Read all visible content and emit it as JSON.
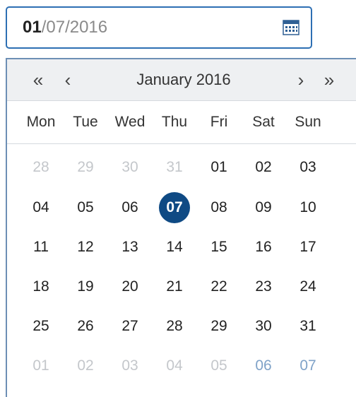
{
  "input": {
    "active_segment": "01",
    "rest": "/07/2016",
    "icon": "calendar-icon"
  },
  "calendar": {
    "prev_year": "«",
    "prev_month": "‹",
    "title": "January 2016",
    "next_month": "›",
    "next_year": "»",
    "weekdays": [
      "Mon",
      "Tue",
      "Wed",
      "Thu",
      "Fri",
      "Sat",
      "Sun"
    ],
    "selected_day": "07",
    "weeks": [
      [
        {
          "label": "28",
          "state": "other"
        },
        {
          "label": "29",
          "state": "other"
        },
        {
          "label": "30",
          "state": "other"
        },
        {
          "label": "31",
          "state": "other"
        },
        {
          "label": "01",
          "state": "current"
        },
        {
          "label": "02",
          "state": "current"
        },
        {
          "label": "03",
          "state": "current"
        }
      ],
      [
        {
          "label": "04",
          "state": "current"
        },
        {
          "label": "05",
          "state": "current"
        },
        {
          "label": "06",
          "state": "current"
        },
        {
          "label": "07",
          "state": "selected"
        },
        {
          "label": "08",
          "state": "current"
        },
        {
          "label": "09",
          "state": "current"
        },
        {
          "label": "10",
          "state": "current"
        }
      ],
      [
        {
          "label": "11",
          "state": "current"
        },
        {
          "label": "12",
          "state": "current"
        },
        {
          "label": "13",
          "state": "current"
        },
        {
          "label": "14",
          "state": "current"
        },
        {
          "label": "15",
          "state": "current"
        },
        {
          "label": "16",
          "state": "current"
        },
        {
          "label": "17",
          "state": "current"
        }
      ],
      [
        {
          "label": "18",
          "state": "current"
        },
        {
          "label": "19",
          "state": "current"
        },
        {
          "label": "20",
          "state": "current"
        },
        {
          "label": "21",
          "state": "current"
        },
        {
          "label": "22",
          "state": "current"
        },
        {
          "label": "23",
          "state": "current"
        },
        {
          "label": "24",
          "state": "current"
        }
      ],
      [
        {
          "label": "25",
          "state": "current"
        },
        {
          "label": "26",
          "state": "current"
        },
        {
          "label": "27",
          "state": "current"
        },
        {
          "label": "28",
          "state": "current"
        },
        {
          "label": "29",
          "state": "current"
        },
        {
          "label": "30",
          "state": "current"
        },
        {
          "label": "31",
          "state": "current"
        }
      ],
      [
        {
          "label": "01",
          "state": "other"
        },
        {
          "label": "02",
          "state": "other"
        },
        {
          "label": "03",
          "state": "other"
        },
        {
          "label": "04",
          "state": "other"
        },
        {
          "label": "05",
          "state": "other"
        },
        {
          "label": "06",
          "state": "other-weekend"
        },
        {
          "label": "07",
          "state": "other-weekend"
        }
      ]
    ]
  },
  "colors": {
    "accent": "#0f4a84",
    "input_border": "#2d6fb3",
    "header_bg": "#eef0f2",
    "other_month_text": "#c4c7cb",
    "next_month_weekend_text": "#7fa2c8"
  }
}
